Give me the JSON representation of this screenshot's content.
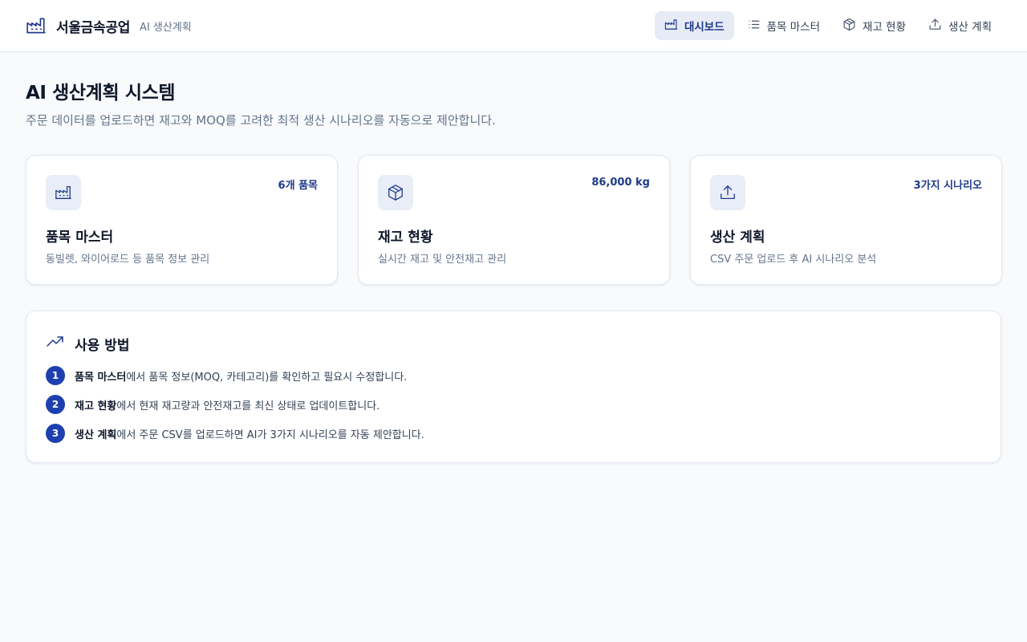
{
  "header": {
    "brand_name": "서울금속공업",
    "brand_sub": "AI 생산계획",
    "logo_icon": "factory-icon",
    "nav": [
      {
        "label": "대시보드",
        "icon": "factory-icon",
        "active": true
      },
      {
        "label": "품목 마스터",
        "icon": "list-icon",
        "active": false
      },
      {
        "label": "재고 현황",
        "icon": "package-icon",
        "active": false
      },
      {
        "label": "생산 계획",
        "icon": "upload-icon",
        "active": false
      }
    ]
  },
  "page": {
    "title": "AI 생산계획 시스템",
    "description": "주문 데이터를 업로드하면 재고와 MOQ를 고려한 최적 생산 시나리오를 자동으로 제안합니다."
  },
  "cards": [
    {
      "title": "품목 마스터",
      "badge": "6개 품목",
      "description": "동빌렛, 와이어로드 등 품목 정보 관리",
      "icon": "factory-icon"
    },
    {
      "title": "재고 현황",
      "badge": "86,000 kg",
      "description": "실시간 재고 및 안전재고 관리",
      "icon": "package-icon"
    },
    {
      "title": "생산 계획",
      "badge": "3가지 시나리오",
      "description": "CSV 주문 업로드 후 AI 시나리오 분석",
      "icon": "upload-icon"
    }
  ],
  "howto": {
    "title": "사용 방법",
    "icon": "trending-up-icon",
    "steps": [
      {
        "num": "1",
        "bold": "품목 마스터",
        "text": "에서 품목 정보(MOQ, 카테고리)를 확인하고 필요시 수정합니다."
      },
      {
        "num": "2",
        "bold": "재고 현황",
        "text": "에서 현재 재고량과 안전재고를 최신 상태로 업데이트합니다."
      },
      {
        "num": "3",
        "bold": "생산 계획",
        "text": "에서 주문 CSV를 업로드하면 AI가 3가지 시나리오를 자동 제안합니다."
      }
    ]
  },
  "colors": {
    "accent": "#1e3a8a",
    "accent_bg": "#e6ebf6",
    "step_badge": "#1e40af",
    "background": "#f8fafc",
    "muted_text": "#64748b"
  }
}
